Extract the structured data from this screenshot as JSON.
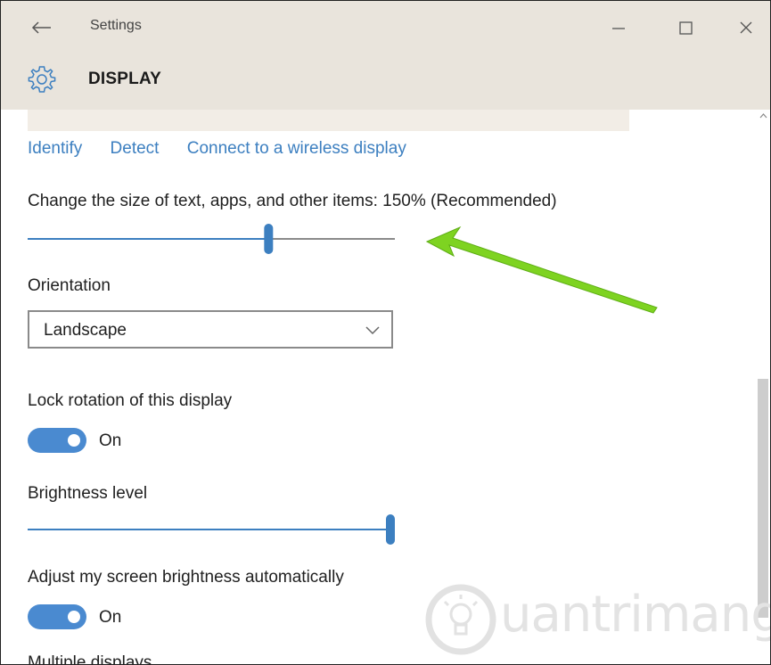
{
  "window": {
    "title": "Settings"
  },
  "header": {
    "page_title": "DISPLAY",
    "icon": "gear-icon"
  },
  "links": {
    "identify": "Identify",
    "detect": "Detect",
    "wireless": "Connect to a wireless display"
  },
  "scale": {
    "label": "Change the size of text, apps, and other items: 150% (Recommended)",
    "value_fraction": 0.66
  },
  "orientation": {
    "label": "Orientation",
    "selected": "Landscape"
  },
  "lock_rotation": {
    "label": "Lock rotation of this display",
    "state": "On"
  },
  "brightness": {
    "label": "Brightness level",
    "value_fraction": 1.0
  },
  "auto_brightness": {
    "label": "Adjust my screen brightness automatically",
    "state": "On"
  },
  "multiple_displays": {
    "label": "Multiple displays"
  },
  "watermark": {
    "text": "uantrimang"
  },
  "colors": {
    "accent": "#3c7fc0",
    "toggle_on": "#4a8ad0",
    "header_bg": "#e9e4dc",
    "arrow": "#7ed321"
  }
}
